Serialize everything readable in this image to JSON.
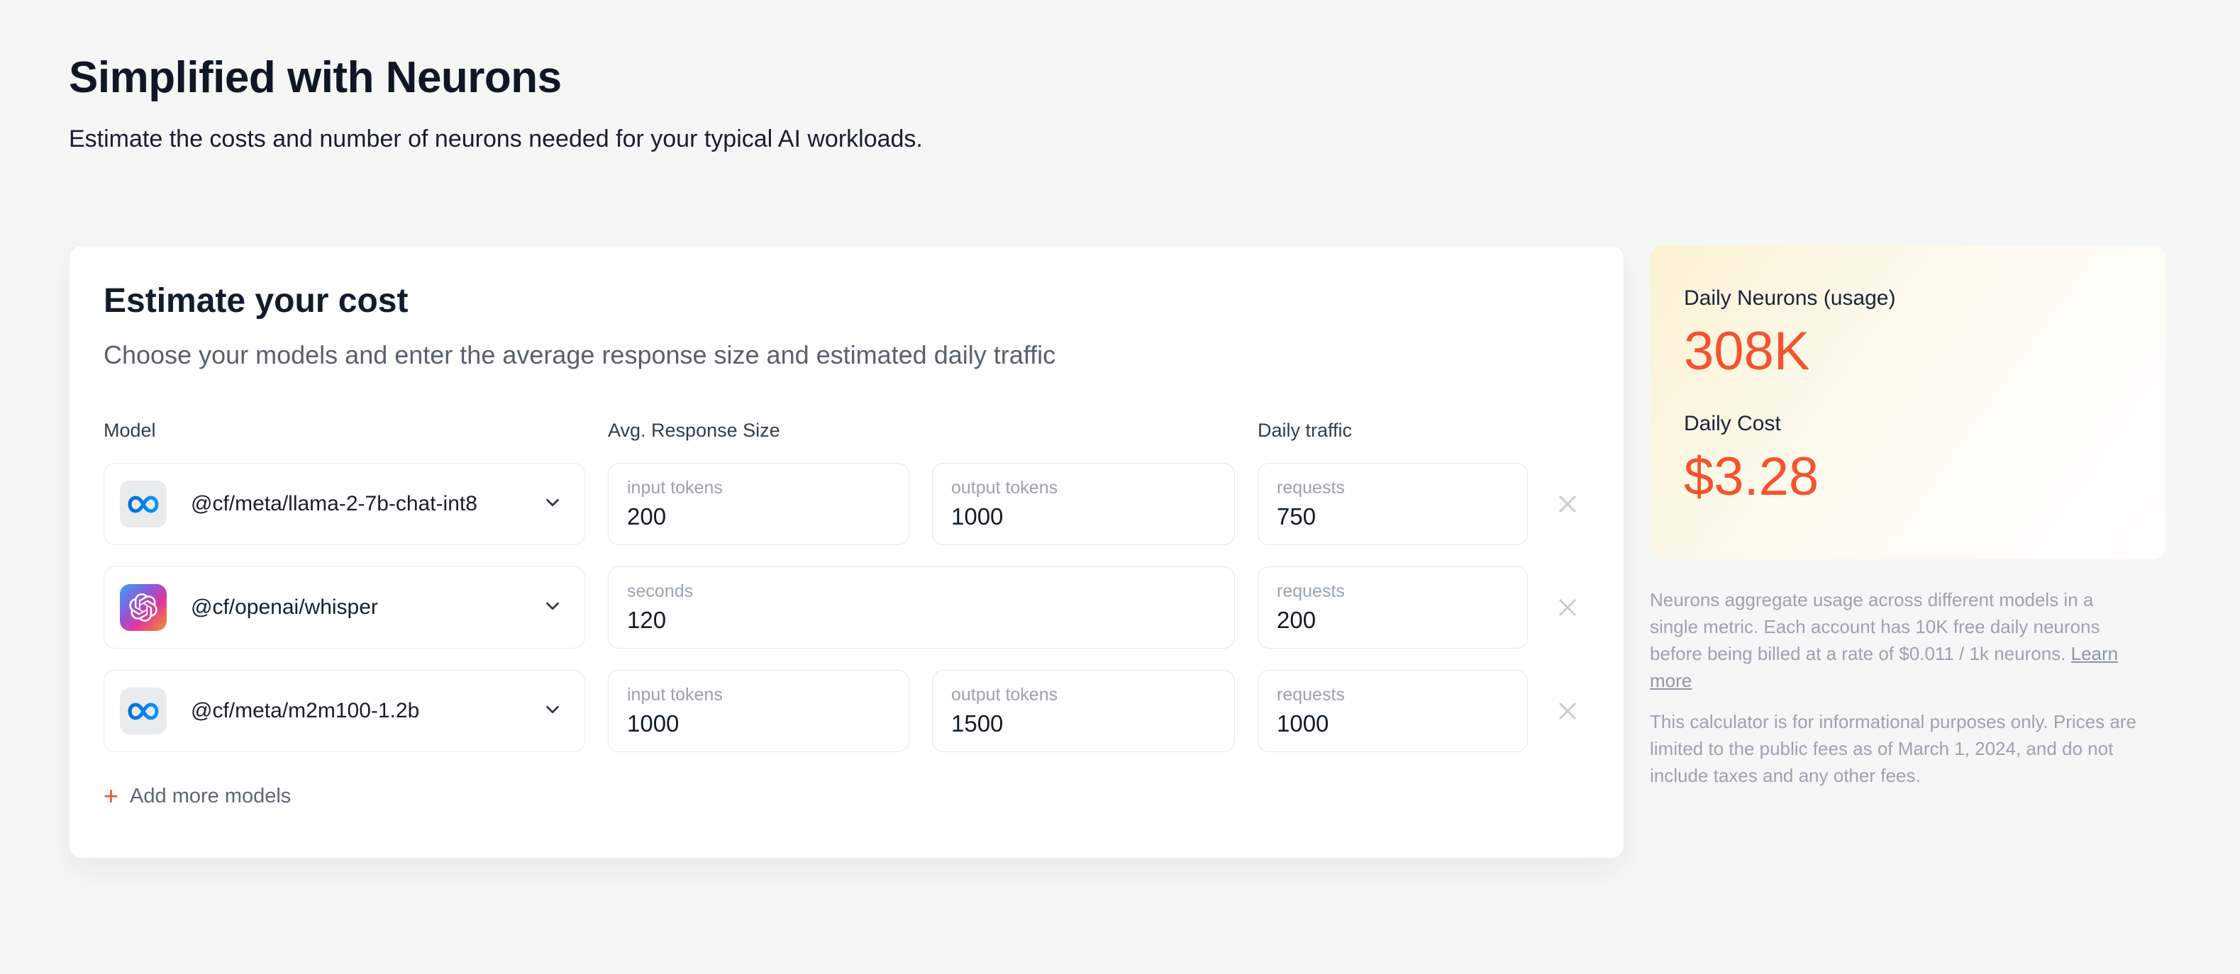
{
  "header": {
    "title": "Simplified with Neurons",
    "subtitle": "Estimate the costs and number of neurons needed for your typical AI workloads."
  },
  "estimator": {
    "title": "Estimate your cost",
    "subtitle": "Choose your models and enter the average response size and estimated daily traffic",
    "columns": {
      "model": "Model",
      "response": "Avg. Response Size",
      "traffic": "Daily traffic"
    },
    "rows": [
      {
        "model": "@cf/meta/llama-2-7b-chat-int8",
        "provider_icon": "meta-icon",
        "fields": [
          {
            "label": "input tokens",
            "value": "200"
          },
          {
            "label": "output tokens",
            "value": "1000"
          },
          {
            "label": "requests",
            "value": "750"
          }
        ]
      },
      {
        "model": "@cf/openai/whisper",
        "provider_icon": "openai-icon",
        "fields": [
          {
            "label": "seconds",
            "value": "120"
          },
          {
            "label": "requests",
            "value": "200"
          }
        ]
      },
      {
        "model": "@cf/meta/m2m100-1.2b",
        "provider_icon": "meta-icon",
        "fields": [
          {
            "label": "input tokens",
            "value": "1000"
          },
          {
            "label": "output tokens",
            "value": "1500"
          },
          {
            "label": "requests",
            "value": "1000"
          }
        ]
      }
    ],
    "add_more_label": "Add more models"
  },
  "summary": {
    "neurons_label": "Daily Neurons (usage)",
    "neurons_value": "308K",
    "cost_label": "Daily Cost",
    "cost_value": "$3.28"
  },
  "notes": {
    "p1_before_link": "Neurons aggregate usage across different models in a single metric. Each account has 10K free daily neurons before being billed at a rate of $0.011 / 1k neurons. ",
    "link_label": "Learn more",
    "p2": "This calculator is for informational purposes only. Prices are limited to the public fees as of March 1, 2024, and do not include taxes and any other fees."
  },
  "colors": {
    "accent_orange": "#f5522d",
    "summary_gradient_start": "#fbf2d4",
    "page_background": "#f5f7f6",
    "meta_blue_start": "#0668E1",
    "meta_blue_end": "#0696FB"
  }
}
